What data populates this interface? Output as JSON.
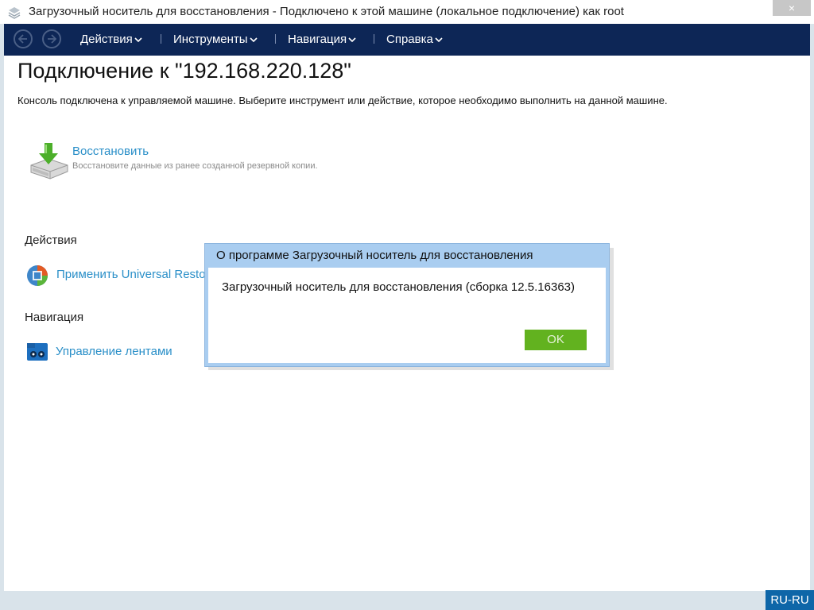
{
  "window": {
    "title": "Загрузочный носитель для восстановления - Подключено к этой машине (локальное подключение) как root",
    "close_label": "×"
  },
  "menubar": {
    "items": [
      {
        "label": "Действия"
      },
      {
        "label": "Инструменты"
      },
      {
        "label": "Навигация"
      },
      {
        "label": "Справка"
      }
    ]
  },
  "page": {
    "title": "Подключение к \"192.168.220.128\"",
    "description": "Консоль подключена к управляемой машине. Выберите инструмент или действие, которое необходимо выполнить на данной машине.",
    "restore": {
      "title": "Восстановить",
      "description": "Восстановите данные из ранее созданной резервной копии."
    },
    "actions_section": {
      "label": "Действия",
      "items": [
        {
          "label": "Применить Universal Restore"
        }
      ]
    },
    "navigation_section": {
      "label": "Навигация",
      "items": [
        {
          "label": "Управление лентами"
        }
      ]
    }
  },
  "dialog": {
    "title": "О программе Загрузочный носитель для восстановления",
    "message": "Загрузочный носитель для восстановления (сборка 12.5.16363)",
    "ok_label": "OK"
  },
  "statusbar": {
    "language": "RU-RU"
  },
  "colors": {
    "menubar_bg": "#0d2656",
    "link": "#2a8fc8",
    "ok_button": "#62b21f",
    "dialog_frame": "#a9cdf0",
    "language_badge": "#0e66a8"
  }
}
